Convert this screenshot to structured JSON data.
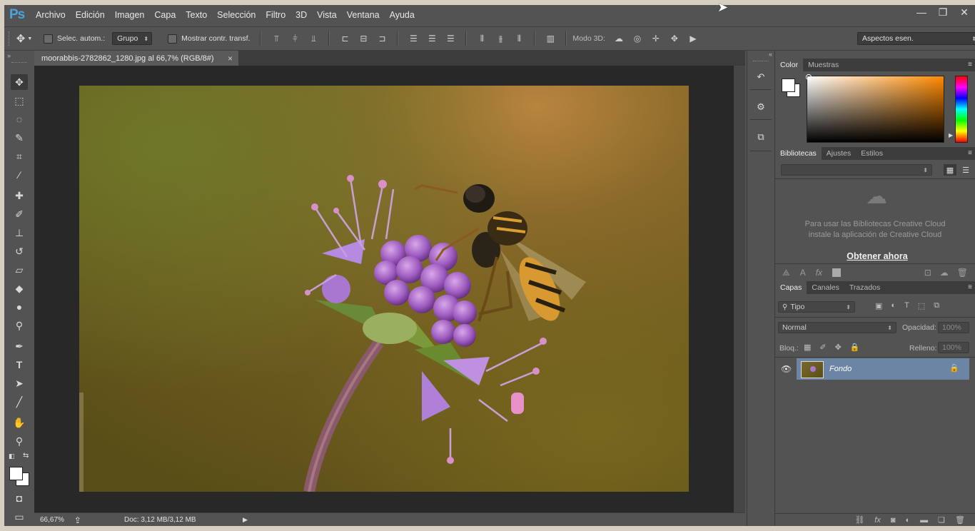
{
  "app": {
    "logo": "Ps"
  },
  "menu": [
    "Archivo",
    "Edición",
    "Imagen",
    "Capa",
    "Texto",
    "Selección",
    "Filtro",
    "3D",
    "Vista",
    "Ventana",
    "Ayuda"
  ],
  "window_controls": {
    "minimize": "—",
    "restore": "❐",
    "close": "✕"
  },
  "options": {
    "auto_select_label": "Selec. autom.:",
    "auto_select_value": "Grupo",
    "show_transform_label": "Mostrar contr. transf.",
    "mode3d_label": "Modo 3D:",
    "workspace": "Aspectos esen."
  },
  "document": {
    "tab_title": "moorabbis-2782862_1280.jpg al 66,7% (RGB/8#)",
    "close": "×",
    "zoom": "66,67%",
    "doc_info": "Doc: 3,12 MB/3,12 MB"
  },
  "color_panel": {
    "tabs": [
      "Color",
      "Muestras"
    ]
  },
  "libraries_panel": {
    "tabs": [
      "Bibliotecas",
      "Ajustes",
      "Estilos"
    ],
    "message_line1": "Para usar las Bibliotecas Creative Cloud",
    "message_line2": "instale la aplicación de Creative Cloud",
    "link": "Obtener ahora"
  },
  "layers_panel": {
    "tabs": [
      "Capas",
      "Canales",
      "Trazados"
    ],
    "filter_value": "Tipo",
    "blend_mode": "Normal",
    "opacity_label": "Opacidad:",
    "opacity_value": "100%",
    "lock_label": "Bloq.:",
    "fill_label": "Relleno:",
    "fill_value": "100%",
    "layers": [
      {
        "name": "Fondo",
        "visible": true,
        "locked": true
      }
    ]
  },
  "colors": {
    "ui_bg": "#535353",
    "canvas_bg": "#282828",
    "selected_layer": "#6c85a4",
    "ps_blue": "#4aa3df"
  }
}
